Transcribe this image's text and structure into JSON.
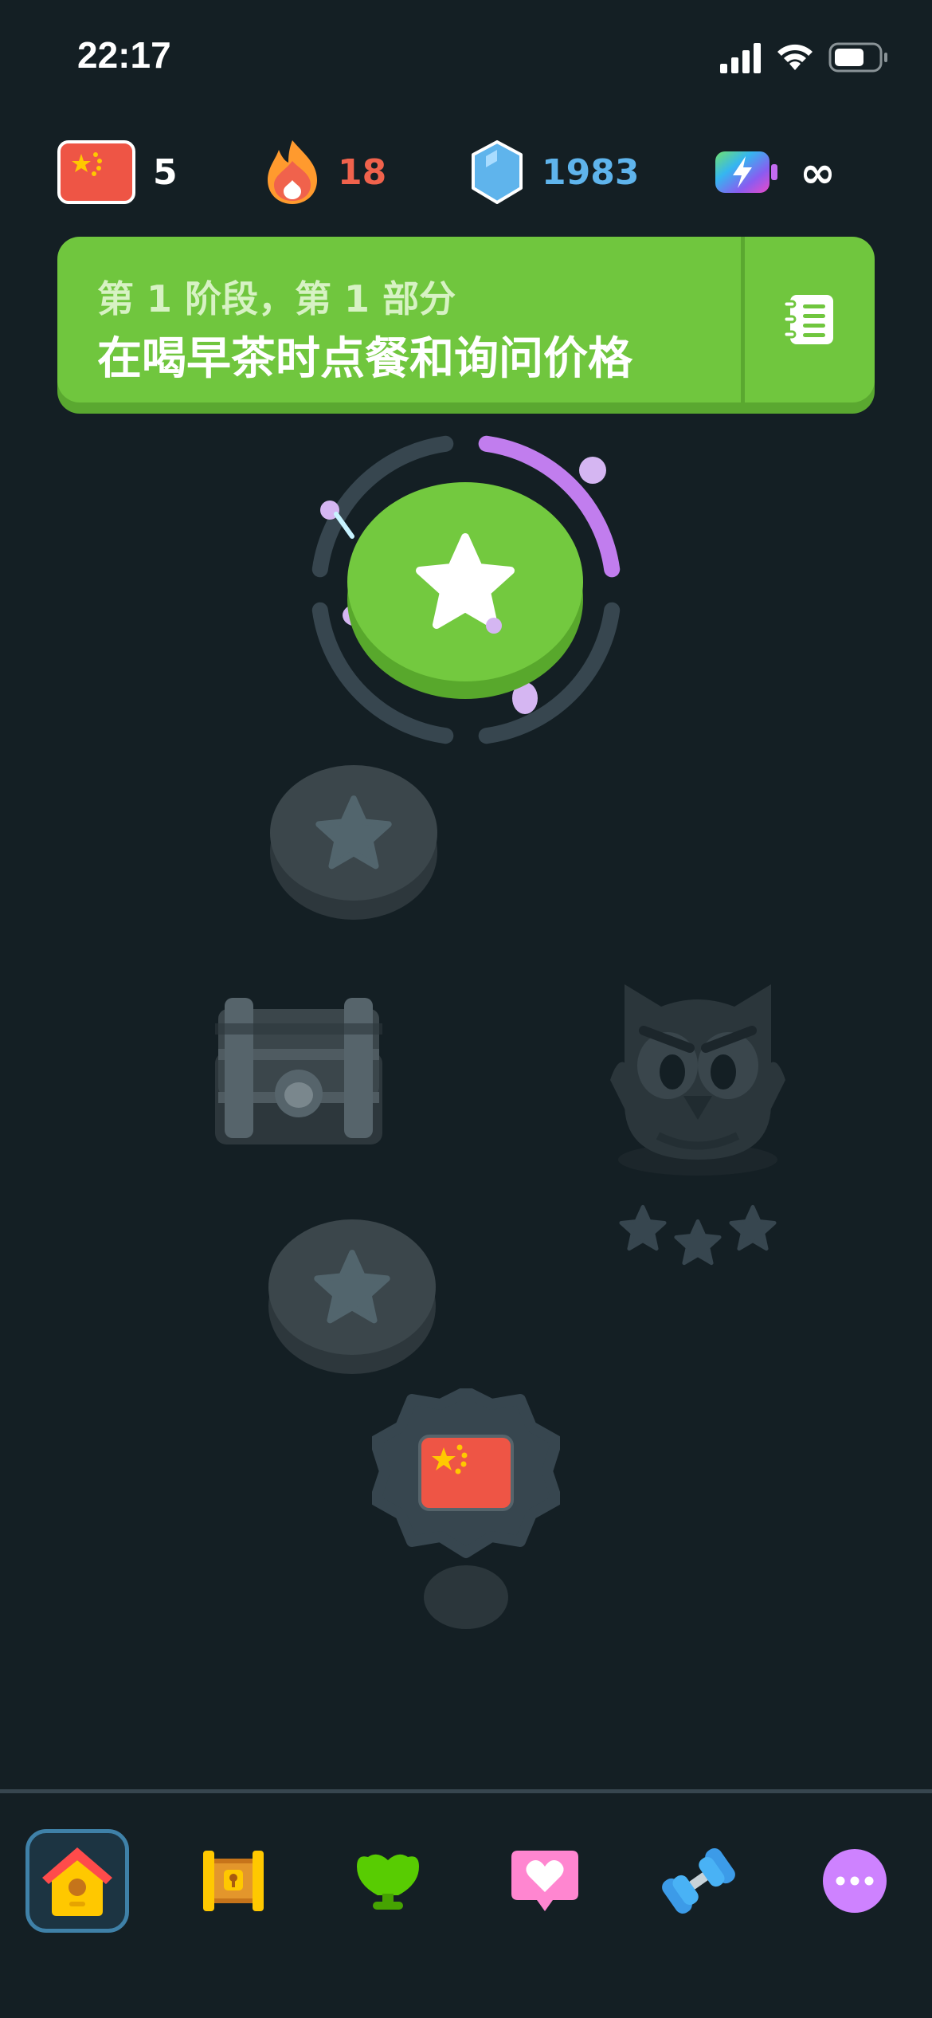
{
  "status_bar": {
    "time": "22:17"
  },
  "stats": {
    "language_count": "5",
    "streak": "18",
    "gems": "1983",
    "energy": "∞"
  },
  "colors": {
    "background": "#141f24",
    "banner_green": "#70c63e",
    "streak_orange": "#ff9a2e",
    "streak_text": "#f0624c",
    "gems_blue": "#5fb4ec",
    "locked_grey": "#3b464b",
    "progress_purple": "#c17dee"
  },
  "banner": {
    "subtitle": "第 1 阶段，第 1 部分",
    "title": "在喝早茶时点餐和询问价格",
    "guide_icon": "notebook-icon"
  },
  "path": {
    "current_lesson_progress": 0.25,
    "nodes": [
      {
        "type": "current-lesson",
        "icon": "star-icon"
      },
      {
        "type": "locked-lesson",
        "icon": "star-icon"
      },
      {
        "type": "locked-chest",
        "icon": "treasure-chest-icon"
      },
      {
        "type": "locked-character",
        "icon": "owl-icon",
        "stars": 3
      },
      {
        "type": "locked-lesson",
        "icon": "star-icon"
      },
      {
        "type": "locked-unit-review",
        "icon": "china-flag-icon"
      }
    ]
  },
  "nav": {
    "items": [
      {
        "name": "learn",
        "icon": "home-icon",
        "active": true
      },
      {
        "name": "letters",
        "icon": "scroll-icon",
        "active": false
      },
      {
        "name": "leaderboards",
        "icon": "shield-icon",
        "active": false
      },
      {
        "name": "friends",
        "icon": "heart-chat-icon",
        "active": false
      },
      {
        "name": "practice",
        "icon": "dumbbell-icon",
        "active": false
      },
      {
        "name": "more",
        "icon": "more-icon",
        "active": false
      }
    ]
  }
}
